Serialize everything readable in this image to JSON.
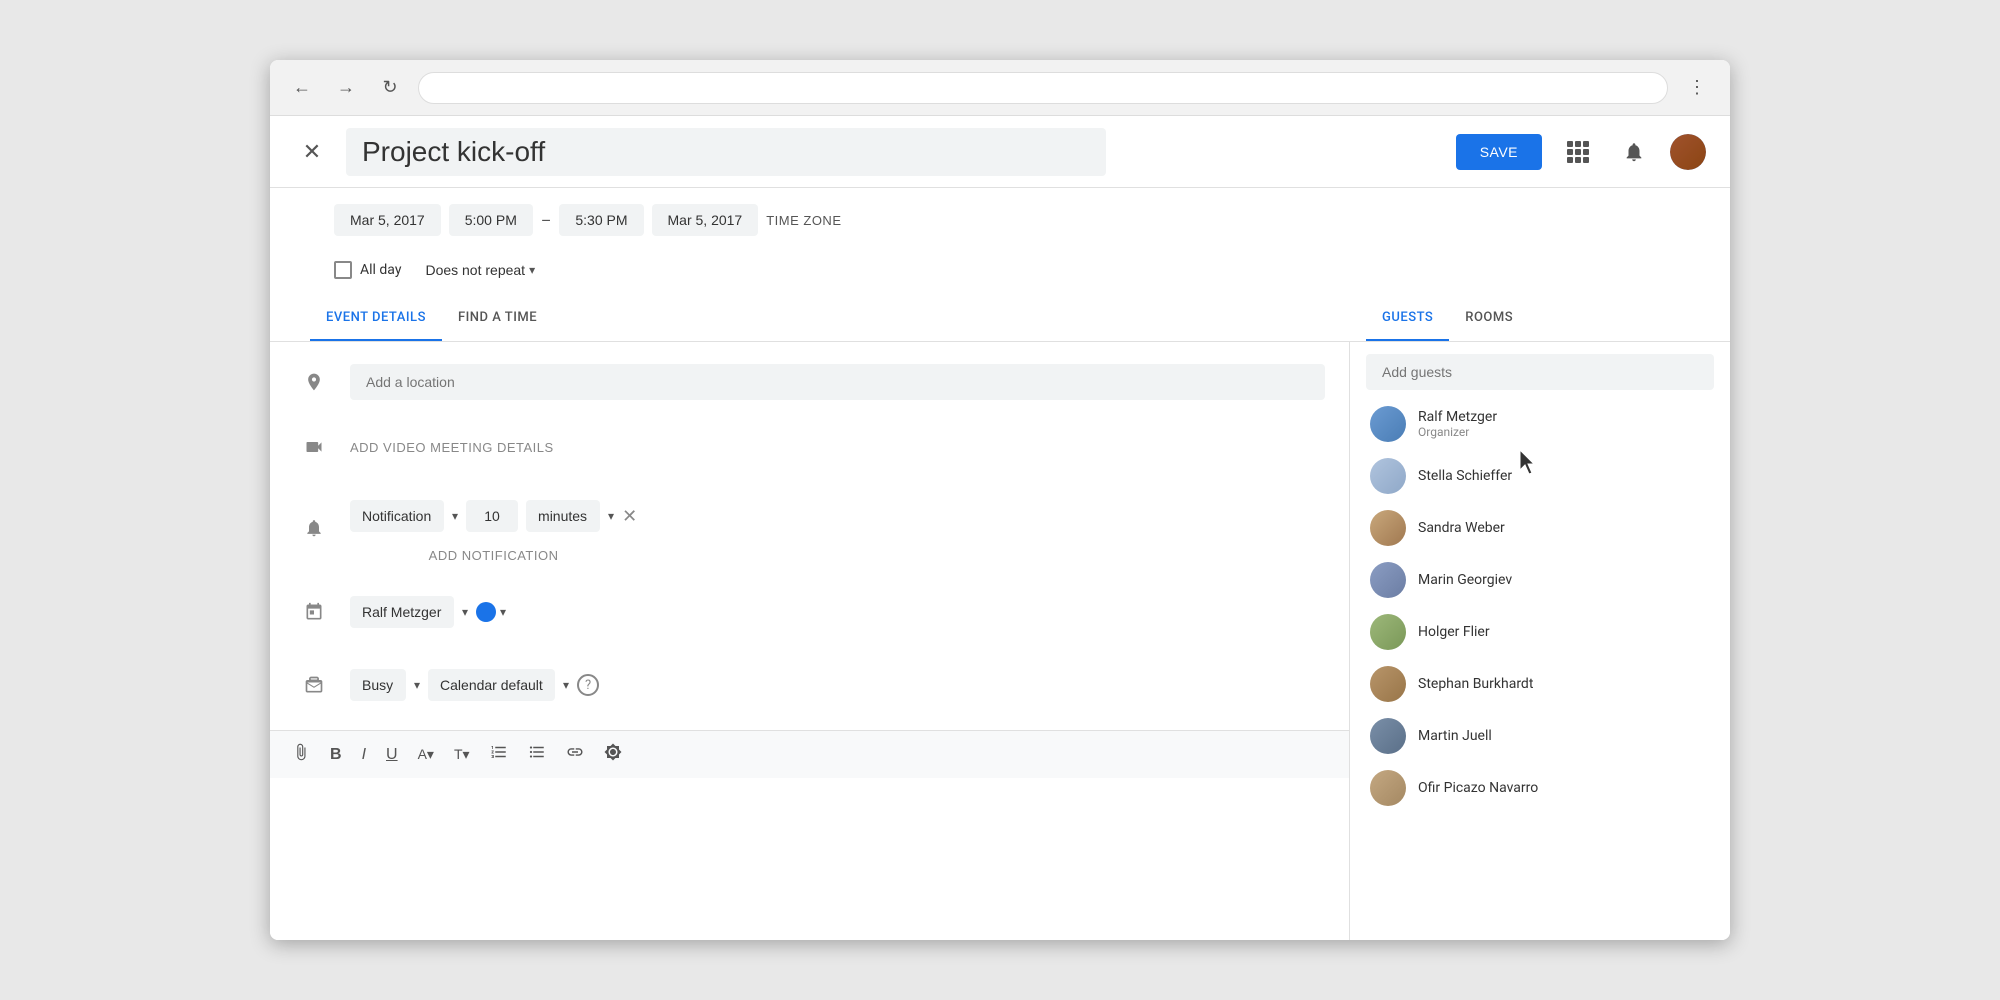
{
  "browser": {
    "back_btn": "←",
    "forward_btn": "→",
    "reload_btn": "↻",
    "menu_btn": "⋮"
  },
  "header": {
    "close_label": "✕",
    "event_title": "Project kick-off",
    "save_label": "SAVE"
  },
  "datetime": {
    "start_date": "Mar 5, 2017",
    "start_time": "5:00 PM",
    "dash": "–",
    "end_time": "5:30 PM",
    "end_date": "Mar 5, 2017",
    "timezone_label": "TIME ZONE"
  },
  "allday": {
    "checkbox_label": "All day",
    "repeat_label": "Does not repeat",
    "chevron": "▾"
  },
  "tabs": {
    "left": [
      {
        "label": "EVENT DETAILS",
        "active": true
      },
      {
        "label": "FIND A TIME",
        "active": false
      }
    ],
    "right": [
      {
        "label": "GUESTS",
        "active": true
      },
      {
        "label": "ROOMS",
        "active": false
      }
    ]
  },
  "form": {
    "location_placeholder": "Add a location",
    "video_label": "ADD VIDEO MEETING DETAILS",
    "notification": {
      "type_label": "Notification",
      "value": "10",
      "unit_label": "minutes",
      "close_label": "✕"
    },
    "add_notification_label": "ADD NOTIFICATION",
    "calendar": {
      "owner_label": "Ralf Metzger",
      "color": "#1a73e8"
    },
    "status": {
      "busy_label": "Busy",
      "visibility_label": "Calendar default"
    }
  },
  "guests": {
    "add_placeholder": "Add guests",
    "list": [
      {
        "name": "Ralf Metzger",
        "role": "Organizer",
        "avatar_class": "av-ralf"
      },
      {
        "name": "Stella Schieffer",
        "role": "",
        "avatar_class": "av-stella"
      },
      {
        "name": "Sandra Weber",
        "role": "",
        "avatar_class": "av-sandra"
      },
      {
        "name": "Marin Georgiev",
        "role": "",
        "avatar_class": "av-marin"
      },
      {
        "name": "Holger Flier",
        "role": "",
        "avatar_class": "av-holger"
      },
      {
        "name": "Stephan Burkhardt",
        "role": "",
        "avatar_class": "av-stephan"
      },
      {
        "name": "Martin Juell",
        "role": "",
        "avatar_class": "av-martin"
      },
      {
        "name": "Ofir Picazo Navarro",
        "role": "",
        "avatar_class": "av-ofir"
      }
    ]
  },
  "toolbar": {
    "attach": "📎",
    "bold": "B",
    "italic": "I",
    "underline": "U",
    "text_color": "A",
    "format": "T",
    "ol": "≡",
    "ul": "≡",
    "link": "🔗",
    "clear": "✕"
  }
}
